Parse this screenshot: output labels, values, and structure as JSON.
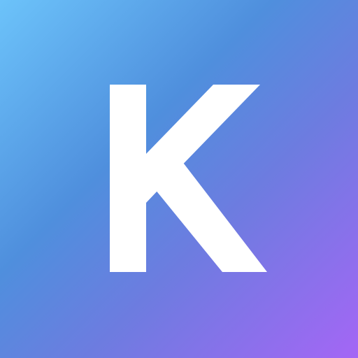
{
  "logo": {
    "letter": "K",
    "background_gradient": [
      "#6cc3fa",
      "#4f8fdd",
      "#6d7ce0",
      "#a466f5"
    ],
    "letter_color": "#ffffff"
  }
}
